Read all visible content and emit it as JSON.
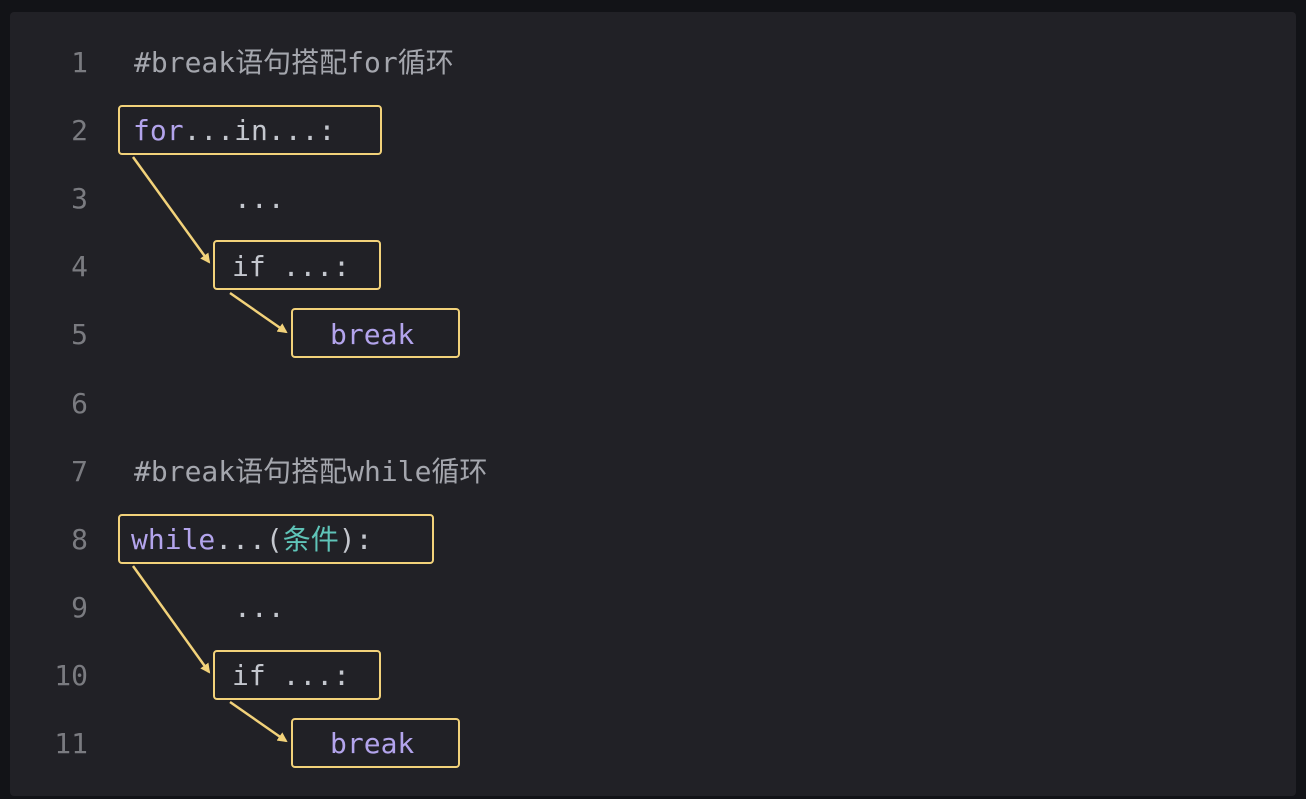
{
  "editor": {
    "lines": [
      {
        "num": "1",
        "parts": {
          "a": "#break语句搭配for循环"
        }
      },
      {
        "num": "2",
        "parts": {
          "kw": "for",
          "rest": "...in...:"
        }
      },
      {
        "num": "3",
        "parts": {
          "rest": "..."
        }
      },
      {
        "num": "4",
        "parts": {
          "rest": "if ...:"
        }
      },
      {
        "num": "5",
        "parts": {
          "kw": "break"
        }
      },
      {
        "num": "6",
        "parts": {}
      },
      {
        "num": "7",
        "parts": {
          "a": "#break语句搭配while循环"
        }
      },
      {
        "num": "8",
        "parts": {
          "kw": "while",
          "mid": "...(",
          "cjk": "条件",
          "end": "):"
        }
      },
      {
        "num": "9",
        "parts": {
          "rest": "..."
        }
      },
      {
        "num": "10",
        "parts": {
          "rest": "if ...:"
        }
      },
      {
        "num": "11",
        "parts": {
          "kw": "break"
        }
      }
    ]
  },
  "colors": {
    "background": "#212126",
    "outer": "#121317",
    "line_number": "#7a7b80",
    "keyword": "#b3a4ec",
    "cjk_text": "#5fc4b8",
    "highlight_box": "#f2d27a"
  }
}
